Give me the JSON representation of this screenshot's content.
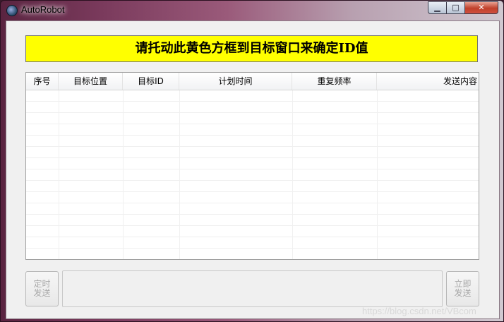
{
  "window": {
    "title": "AutoRobot",
    "controls": {
      "minimize": "▁",
      "maximize": "□",
      "close": "✕"
    }
  },
  "banner": {
    "text": "请托动此黄色方框到目标窗口来确定ID值"
  },
  "list": {
    "columns": [
      "序号",
      "目标位置",
      "目标ID",
      "计划时间",
      "重复频率",
      "发送内容"
    ],
    "rows": []
  },
  "bottom": {
    "timed_send_label": "定时\n发送",
    "send_now_label": "立即\n发送",
    "message_value": ""
  },
  "watermark": "https://blog.csdn.net/VBcom"
}
